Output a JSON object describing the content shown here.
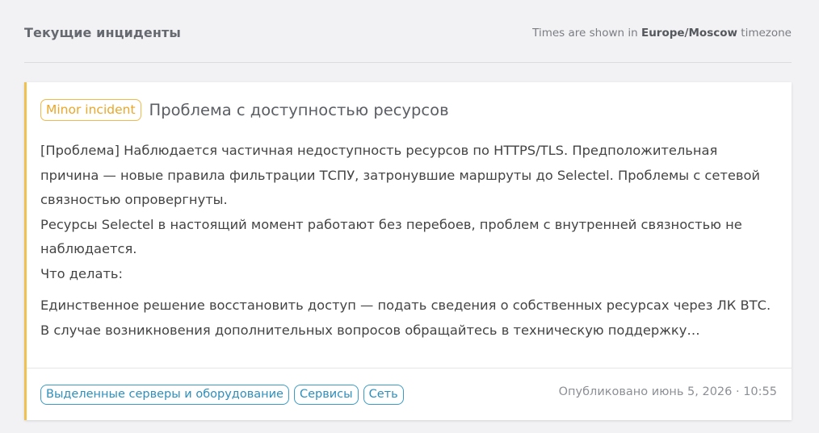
{
  "header": {
    "title": "Текущие инциденты",
    "tz_prefix": "Times are shown in",
    "tz_name": "Europe/Moscow",
    "tz_suffix": "timezone"
  },
  "incident": {
    "badge": "Minor incident",
    "title": "Проблема с доступностью ресурсов",
    "paragraphs": [
      "[Проблема] Наблюдается частичная недоступность ресурсов по HTTPS/TLS. Предположительная причина — новые правила фильтрации ТСПУ, затронувшие маршруты до Selectel. Проблемы с сетевой связностью опровергнуты.",
      "Ресурсы Selectel в настоящий момент работают без перебоев, проблем с внутренней связностью не наблюдается.",
      "Что делать:",
      "Единственное решение восстановить доступ — подать сведения о собственных ресурсах через ЛК ВТС. В случае возникновения дополнительных вопросов обращайтесь в техническую поддержку…"
    ],
    "tags": [
      "Выделенные серверы и оборудование",
      "Сервисы",
      "Сеть"
    ],
    "published": "Опубликовано июнь 5, 2026 · 10:55"
  },
  "colors": {
    "minor_incident_accent": "#f0b948",
    "tag_accent": "#3a9bc5",
    "background": "#f2f2f4"
  }
}
